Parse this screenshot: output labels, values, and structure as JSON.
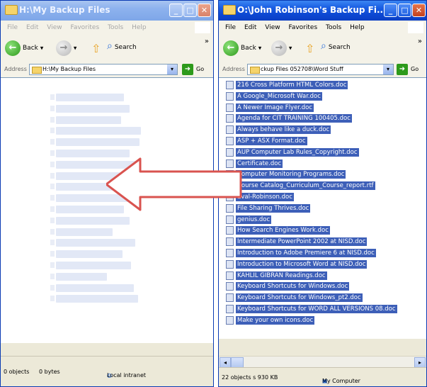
{
  "left_window": {
    "title": "H:\\My Backup Files",
    "menu": [
      "File",
      "Edit",
      "View",
      "Favorites",
      "Tools",
      "Help"
    ],
    "toolbar": {
      "back_label": "Back",
      "search_label": "Search"
    },
    "address": {
      "label": "Address",
      "value": "H:\\My Backup Files",
      "go_label": "Go"
    },
    "status": {
      "objects": "0 objects",
      "bytes": "0 bytes",
      "zone": "Local intranet"
    },
    "ghost_rows": 19
  },
  "right_window": {
    "title": "O:\\John Robinson's Backup Fi...",
    "menu": [
      "File",
      "Edit",
      "View",
      "Favorites",
      "Tools",
      "Help"
    ],
    "toolbar": {
      "back_label": "Back",
      "search_label": "Search"
    },
    "address": {
      "label": "Address",
      "value": "ckup Files 052708\\Word Stuff",
      "go_label": "Go"
    },
    "files": [
      "216 Cross Platform HTML Colors.doc",
      "A Google_Microsoft War.doc",
      "A Newer Image Flyer.doc",
      "Agenda for CIT TRAINING 100405.doc",
      "Always behave like a duck.doc",
      "ASP + ASX Format.doc",
      "AUP Computer Lab Rules_Copyright.doc",
      "Certificate.doc",
      "Computer Monitoring Programs.doc",
      "Course Catalog_Curriculum_Course_report.rtf",
      "Eval-Robinson.doc",
      "File Sharing Thrives.doc",
      "genius.doc",
      "How Search Engines Work.doc",
      "Intermediate PowerPoint 2002 at NISD.doc",
      "Introduction to Adobe Premiere 6 at NISD.doc",
      "Introduction to Microsoft Word at NISD.doc",
      "KAHLIL GIBRAN Readings.doc",
      "Keyboard Shortcuts for Windows.doc",
      "Keyboard Shortcuts for Windows_pt2.doc",
      "Keyboard Shortcuts for WORD ALL VERSIONS 08.doc",
      "Make your own icons.doc"
    ],
    "status": {
      "objects": "22 objects s 930 KB",
      "zone": "My Computer"
    }
  },
  "colors": {
    "arrow_fill": "#ffffff",
    "arrow_stroke": "#d9534f",
    "selection": "#3d5fb8"
  }
}
